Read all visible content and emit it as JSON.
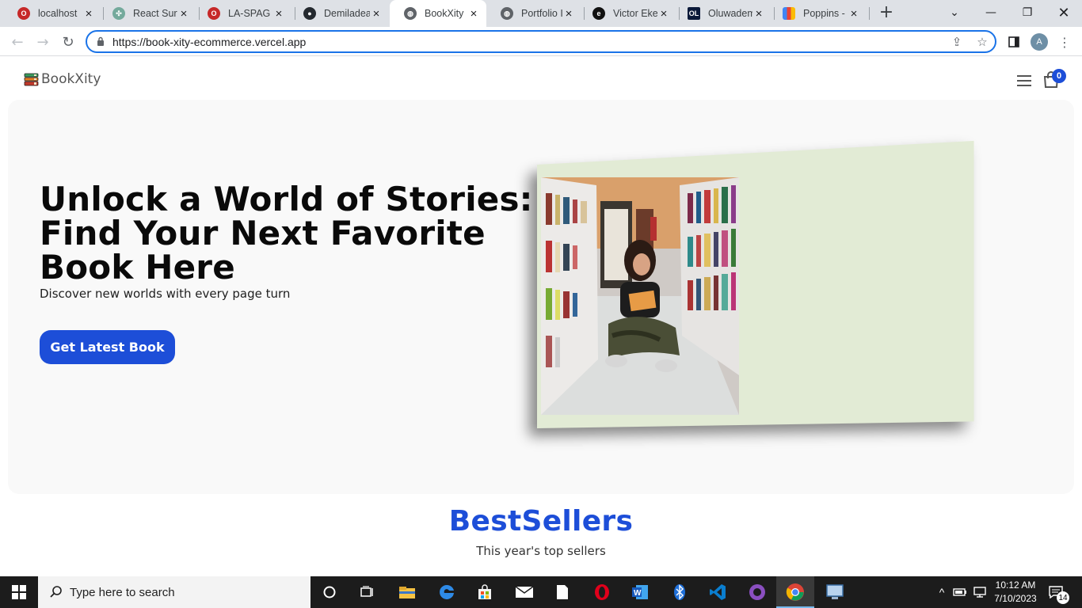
{
  "browser": {
    "tabs": [
      {
        "title": "localhost",
        "favicon": "opera-red-icon",
        "color": "#c62828"
      },
      {
        "title": "React Surv",
        "favicon": "openai-icon",
        "color": "#74aa9c"
      },
      {
        "title": "LA-SPAG",
        "favicon": "opera-red-icon",
        "color": "#c62828"
      },
      {
        "title": "Demiladea",
        "favicon": "github-icon",
        "color": "#24292f"
      },
      {
        "title": "BookXity",
        "favicon": "globe-icon",
        "color": "#5f6368",
        "active": true
      },
      {
        "title": "Portfolio Ic",
        "favicon": "globe-icon",
        "color": "#5f6368"
      },
      {
        "title": "Victor Eke",
        "favicon": "ve-logo-icon",
        "color": "#111111"
      },
      {
        "title": "Oluwadem",
        "favicon": "ol-logo-icon",
        "color": "#0b1a3a"
      },
      {
        "title": "Poppins - ",
        "favicon": "google-fonts-icon",
        "color": "#4285f4"
      }
    ],
    "url": "https://book-xity-ecommerce.vercel.app",
    "profile_initial": "A"
  },
  "site": {
    "logo_text": "BookXity",
    "cart_count": "0",
    "hero": {
      "title_lines": [
        "Unlock a World of Stories:",
        "Find Your Next Favorite",
        "Book Here"
      ],
      "subtitle": "Discover new worlds with every page turn",
      "cta_label": "Get Latest Book",
      "image_alt": "girl-reading-in-bookstore"
    },
    "bestsellers": {
      "title": "BestSellers",
      "subtitle": "This year's top sellers"
    },
    "colors": {
      "accent": "#1d4ed8",
      "hero_bg": "#f9f9f9",
      "card_bg": "#e2ebd5"
    }
  },
  "taskbar": {
    "search_placeholder": "Type here to search",
    "time": "10:12 AM",
    "date": "7/10/2023",
    "notification_count": "14"
  }
}
